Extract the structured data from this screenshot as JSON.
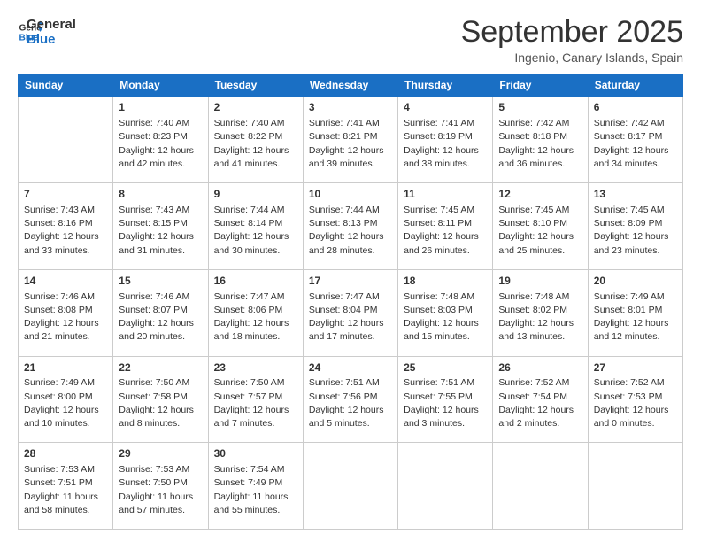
{
  "header": {
    "logo_line1": "General",
    "logo_line2": "Blue",
    "month": "September 2025",
    "location": "Ingenio, Canary Islands, Spain"
  },
  "weekdays": [
    "Sunday",
    "Monday",
    "Tuesday",
    "Wednesday",
    "Thursday",
    "Friday",
    "Saturday"
  ],
  "weeks": [
    [
      {
        "day": "",
        "info": ""
      },
      {
        "day": "1",
        "info": "Sunrise: 7:40 AM\nSunset: 8:23 PM\nDaylight: 12 hours\nand 42 minutes."
      },
      {
        "day": "2",
        "info": "Sunrise: 7:40 AM\nSunset: 8:22 PM\nDaylight: 12 hours\nand 41 minutes."
      },
      {
        "day": "3",
        "info": "Sunrise: 7:41 AM\nSunset: 8:21 PM\nDaylight: 12 hours\nand 39 minutes."
      },
      {
        "day": "4",
        "info": "Sunrise: 7:41 AM\nSunset: 8:19 PM\nDaylight: 12 hours\nand 38 minutes."
      },
      {
        "day": "5",
        "info": "Sunrise: 7:42 AM\nSunset: 8:18 PM\nDaylight: 12 hours\nand 36 minutes."
      },
      {
        "day": "6",
        "info": "Sunrise: 7:42 AM\nSunset: 8:17 PM\nDaylight: 12 hours\nand 34 minutes."
      }
    ],
    [
      {
        "day": "7",
        "info": "Sunrise: 7:43 AM\nSunset: 8:16 PM\nDaylight: 12 hours\nand 33 minutes."
      },
      {
        "day": "8",
        "info": "Sunrise: 7:43 AM\nSunset: 8:15 PM\nDaylight: 12 hours\nand 31 minutes."
      },
      {
        "day": "9",
        "info": "Sunrise: 7:44 AM\nSunset: 8:14 PM\nDaylight: 12 hours\nand 30 minutes."
      },
      {
        "day": "10",
        "info": "Sunrise: 7:44 AM\nSunset: 8:13 PM\nDaylight: 12 hours\nand 28 minutes."
      },
      {
        "day": "11",
        "info": "Sunrise: 7:45 AM\nSunset: 8:11 PM\nDaylight: 12 hours\nand 26 minutes."
      },
      {
        "day": "12",
        "info": "Sunrise: 7:45 AM\nSunset: 8:10 PM\nDaylight: 12 hours\nand 25 minutes."
      },
      {
        "day": "13",
        "info": "Sunrise: 7:45 AM\nSunset: 8:09 PM\nDaylight: 12 hours\nand 23 minutes."
      }
    ],
    [
      {
        "day": "14",
        "info": "Sunrise: 7:46 AM\nSunset: 8:08 PM\nDaylight: 12 hours\nand 21 minutes."
      },
      {
        "day": "15",
        "info": "Sunrise: 7:46 AM\nSunset: 8:07 PM\nDaylight: 12 hours\nand 20 minutes."
      },
      {
        "day": "16",
        "info": "Sunrise: 7:47 AM\nSunset: 8:06 PM\nDaylight: 12 hours\nand 18 minutes."
      },
      {
        "day": "17",
        "info": "Sunrise: 7:47 AM\nSunset: 8:04 PM\nDaylight: 12 hours\nand 17 minutes."
      },
      {
        "day": "18",
        "info": "Sunrise: 7:48 AM\nSunset: 8:03 PM\nDaylight: 12 hours\nand 15 minutes."
      },
      {
        "day": "19",
        "info": "Sunrise: 7:48 AM\nSunset: 8:02 PM\nDaylight: 12 hours\nand 13 minutes."
      },
      {
        "day": "20",
        "info": "Sunrise: 7:49 AM\nSunset: 8:01 PM\nDaylight: 12 hours\nand 12 minutes."
      }
    ],
    [
      {
        "day": "21",
        "info": "Sunrise: 7:49 AM\nSunset: 8:00 PM\nDaylight: 12 hours\nand 10 minutes."
      },
      {
        "day": "22",
        "info": "Sunrise: 7:50 AM\nSunset: 7:58 PM\nDaylight: 12 hours\nand 8 minutes."
      },
      {
        "day": "23",
        "info": "Sunrise: 7:50 AM\nSunset: 7:57 PM\nDaylight: 12 hours\nand 7 minutes."
      },
      {
        "day": "24",
        "info": "Sunrise: 7:51 AM\nSunset: 7:56 PM\nDaylight: 12 hours\nand 5 minutes."
      },
      {
        "day": "25",
        "info": "Sunrise: 7:51 AM\nSunset: 7:55 PM\nDaylight: 12 hours\nand 3 minutes."
      },
      {
        "day": "26",
        "info": "Sunrise: 7:52 AM\nSunset: 7:54 PM\nDaylight: 12 hours\nand 2 minutes."
      },
      {
        "day": "27",
        "info": "Sunrise: 7:52 AM\nSunset: 7:53 PM\nDaylight: 12 hours\nand 0 minutes."
      }
    ],
    [
      {
        "day": "28",
        "info": "Sunrise: 7:53 AM\nSunset: 7:51 PM\nDaylight: 11 hours\nand 58 minutes."
      },
      {
        "day": "29",
        "info": "Sunrise: 7:53 AM\nSunset: 7:50 PM\nDaylight: 11 hours\nand 57 minutes."
      },
      {
        "day": "30",
        "info": "Sunrise: 7:54 AM\nSunset: 7:49 PM\nDaylight: 11 hours\nand 55 minutes."
      },
      {
        "day": "",
        "info": ""
      },
      {
        "day": "",
        "info": ""
      },
      {
        "day": "",
        "info": ""
      },
      {
        "day": "",
        "info": ""
      }
    ]
  ]
}
